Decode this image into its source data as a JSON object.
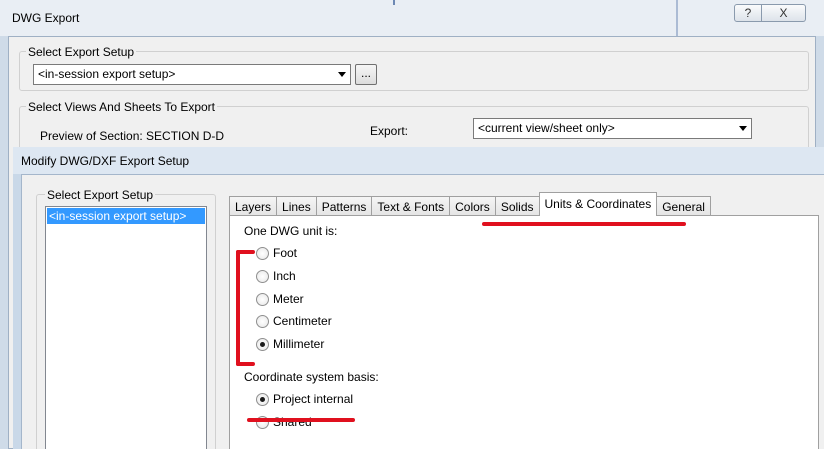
{
  "colors": {
    "selection": "#3399ff",
    "annotation": "#e0101e"
  },
  "dwg_export": {
    "title": "DWG Export",
    "help_button": "?",
    "close_button": "X",
    "export_setup_group": "Select Export Setup",
    "export_setup_value": "<in-session export setup>",
    "browse_button": "...",
    "views_group": "Select Views And Sheets To Export",
    "preview_label": "Preview of Section: SECTION D-D",
    "export_label": "Export:",
    "export_value": "<current view/sheet only>"
  },
  "modify_dialog": {
    "title": "Modify DWG/DXF Export Setup",
    "setup_group": "Select Export Setup",
    "setup_items": [
      "<in-session export setup>"
    ],
    "tabs": [
      "Layers",
      "Lines",
      "Patterns",
      "Text & Fonts",
      "Colors",
      "Solids",
      "Units & Coordinates",
      "General"
    ],
    "active_tab": "Units & Coordinates",
    "units_label": "One DWG unit is:",
    "units": [
      {
        "label": "Foot",
        "checked": false
      },
      {
        "label": "Inch",
        "checked": false
      },
      {
        "label": "Meter",
        "checked": false
      },
      {
        "label": "Centimeter",
        "checked": false
      },
      {
        "label": "Millimeter",
        "checked": true
      }
    ],
    "coord_label": "Coordinate system basis:",
    "coords": [
      {
        "label": "Project internal",
        "checked": true
      },
      {
        "label": "Shared",
        "checked": false
      }
    ]
  }
}
